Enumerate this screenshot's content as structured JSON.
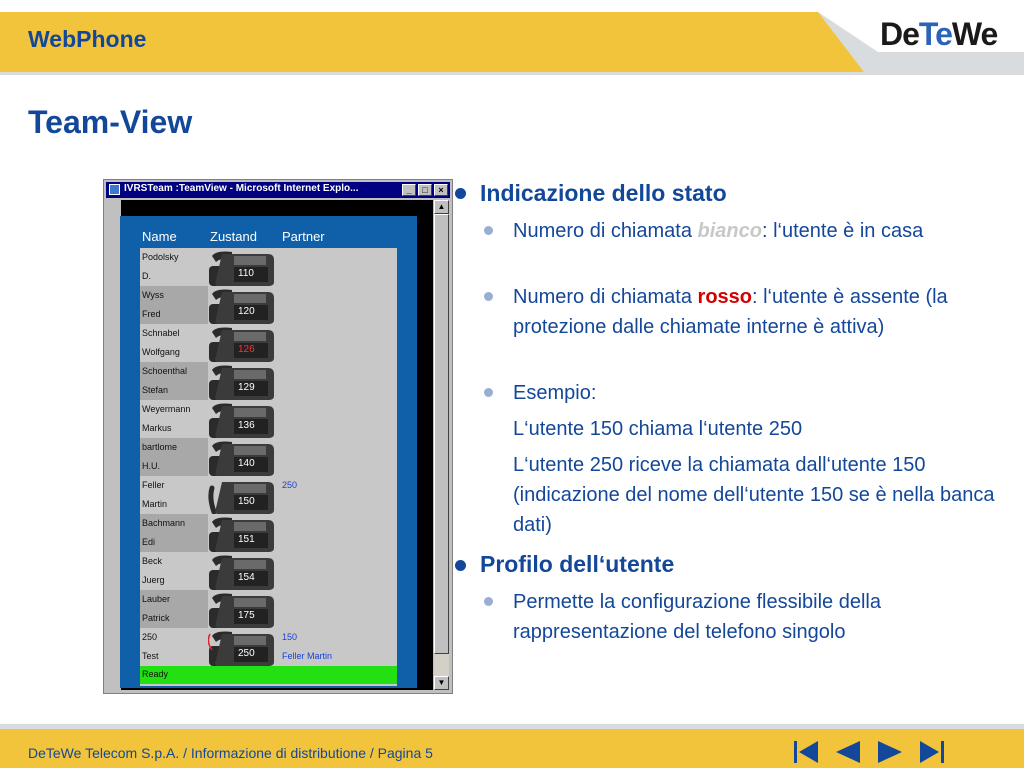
{
  "header": {
    "title": "WebPhone",
    "logo": "DeTeWe"
  },
  "page_title": "Team-View",
  "window": {
    "title": "IVRSTeam :TeamView - Microsoft Internet Explo...",
    "controls": [
      "minimize-icon",
      "maximize-icon",
      "close-icon"
    ],
    "columns": [
      "Name",
      "Zustand",
      "Partner"
    ],
    "rows": [
      {
        "name1": "Podolsky",
        "name2": "D.",
        "ext": "110",
        "partner1": "",
        "partner2": "",
        "ext_color": "white",
        "handset": "on-hook",
        "highlight": false
      },
      {
        "name1": "Wyss",
        "name2": "Fred",
        "ext": "120",
        "partner1": "",
        "partner2": "",
        "ext_color": "white",
        "handset": "on-hook",
        "highlight": true
      },
      {
        "name1": "Schnabel",
        "name2": "Wolfgang",
        "ext": "126",
        "partner1": "",
        "partner2": "",
        "ext_color": "red",
        "handset": "on-hook",
        "highlight": false
      },
      {
        "name1": "Schoenthal",
        "name2": "Stefan",
        "ext": "129",
        "partner1": "",
        "partner2": "",
        "ext_color": "white",
        "handset": "on-hook",
        "highlight": true
      },
      {
        "name1": "Weyermann",
        "name2": "Markus",
        "ext": "136",
        "partner1": "",
        "partner2": "",
        "ext_color": "white",
        "handset": "on-hook",
        "highlight": false
      },
      {
        "name1": "bartlome",
        "name2": "H.U.",
        "ext": "140",
        "partner1": "",
        "partner2": "",
        "ext_color": "white",
        "handset": "on-hook",
        "highlight": true
      },
      {
        "name1": "Feller",
        "name2": "Martin",
        "ext": "150",
        "partner1": "250",
        "partner2": "",
        "ext_color": "white",
        "handset": "off-hook",
        "highlight": false
      },
      {
        "name1": "Bachmann",
        "name2": "Edi",
        "ext": "151",
        "partner1": "",
        "partner2": "",
        "ext_color": "white",
        "handset": "on-hook",
        "highlight": true
      },
      {
        "name1": "Beck",
        "name2": "Juerg",
        "ext": "154",
        "partner1": "",
        "partner2": "",
        "ext_color": "white",
        "handset": "on-hook",
        "highlight": false
      },
      {
        "name1": "Lauber",
        "name2": "Patrick",
        "ext": "175",
        "partner1": "",
        "partner2": "",
        "ext_color": "white",
        "handset": "on-hook",
        "highlight": true
      },
      {
        "name1": "250",
        "name2": "Test",
        "ext": "250",
        "partner1": "150",
        "partner2": "Feller Martin",
        "ext_color": "white",
        "handset": "ringing",
        "highlight": false
      }
    ],
    "status": "Ready"
  },
  "content": {
    "s1": {
      "title": "Indicazione dello stato"
    },
    "b1": {
      "pre": "Numero di chiamata ",
      "kw": "bianco",
      "post": ": l‘utente è in casa"
    },
    "b2": {
      "pre": "Numero di chiamata ",
      "kw": "rosso",
      "post": ": l‘utente è assente (la protezione dalle chiamate interne è attiva)"
    },
    "b3": {
      "text": "Esempio:"
    },
    "p1": "L‘utente 150 chiama l‘utente 250",
    "p2": "L‘utente 250 riceve la chiamata dall‘utente 150 (indicazione del nome dell‘utente 150 se è nella banca dati)",
    "s2": {
      "title": "Profilo dell‘utente"
    },
    "b4": {
      "text": "Permette la configurazione flessibile della rappresentazione del telefono singolo"
    }
  },
  "footer": {
    "text": "DeTeWe Telecom S.p.A. / Informazione di distributione / Pagina 5",
    "nav": [
      "first-page-icon",
      "previous-page-icon",
      "next-page-icon",
      "last-page-icon"
    ]
  },
  "colors": {
    "header": "#f2c43b",
    "title_blue": "#13479a",
    "frame_blue": "#0f60a8",
    "status_green": "#22e011",
    "keyword_red": "#d40000"
  }
}
